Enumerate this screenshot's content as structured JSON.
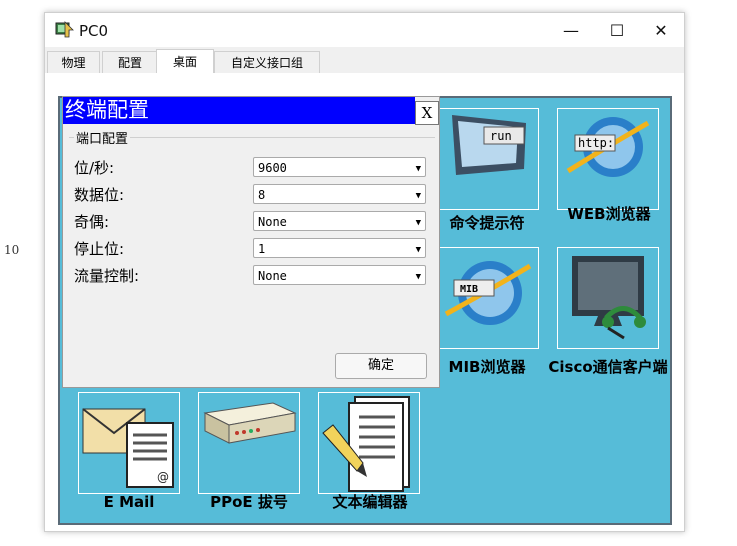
{
  "side_label": "10",
  "window": {
    "title": "PC0",
    "controls": {
      "minimize": "—",
      "maximize": "☐",
      "close": "✕"
    }
  },
  "tabs": [
    {
      "label": "物理"
    },
    {
      "label": "配置"
    },
    {
      "label": "桌面"
    },
    {
      "label": "自定义接口组"
    }
  ],
  "active_tab": "桌面",
  "desktop_apps": [
    {
      "label": "命令提示符",
      "icon": "terminal-run-icon",
      "icon_text": "run"
    },
    {
      "label": "WEB浏览器",
      "icon": "web-browser-icon",
      "icon_text": "http:"
    },
    {
      "label": "MIB浏览器",
      "icon": "mib-browser-icon",
      "icon_text": "MIB"
    },
    {
      "label": "Cisco通信客户端",
      "icon": "cisco-ip-communicator-icon"
    },
    {
      "label": "E Mail",
      "icon": "email-icon",
      "icon_text": "@"
    },
    {
      "label": "PPoE 拔号",
      "icon": "pppoe-dialer-icon"
    },
    {
      "label": "文本编辑器",
      "icon": "text-editor-icon"
    }
  ],
  "dialog": {
    "title": "终端配置",
    "close": "X",
    "group_label": "端口配置",
    "fields": [
      {
        "label": "位/秒:",
        "value": "9600"
      },
      {
        "label": "数据位:",
        "value": "8"
      },
      {
        "label": "奇偶:",
        "value": "None"
      },
      {
        "label": "停止位:",
        "value": "1"
      },
      {
        "label": "流量控制:",
        "value": "None"
      }
    ],
    "ok_button": "确定"
  },
  "colors": {
    "desktop": "#56bcd8",
    "dialog_title_bar": "#0000ff"
  }
}
